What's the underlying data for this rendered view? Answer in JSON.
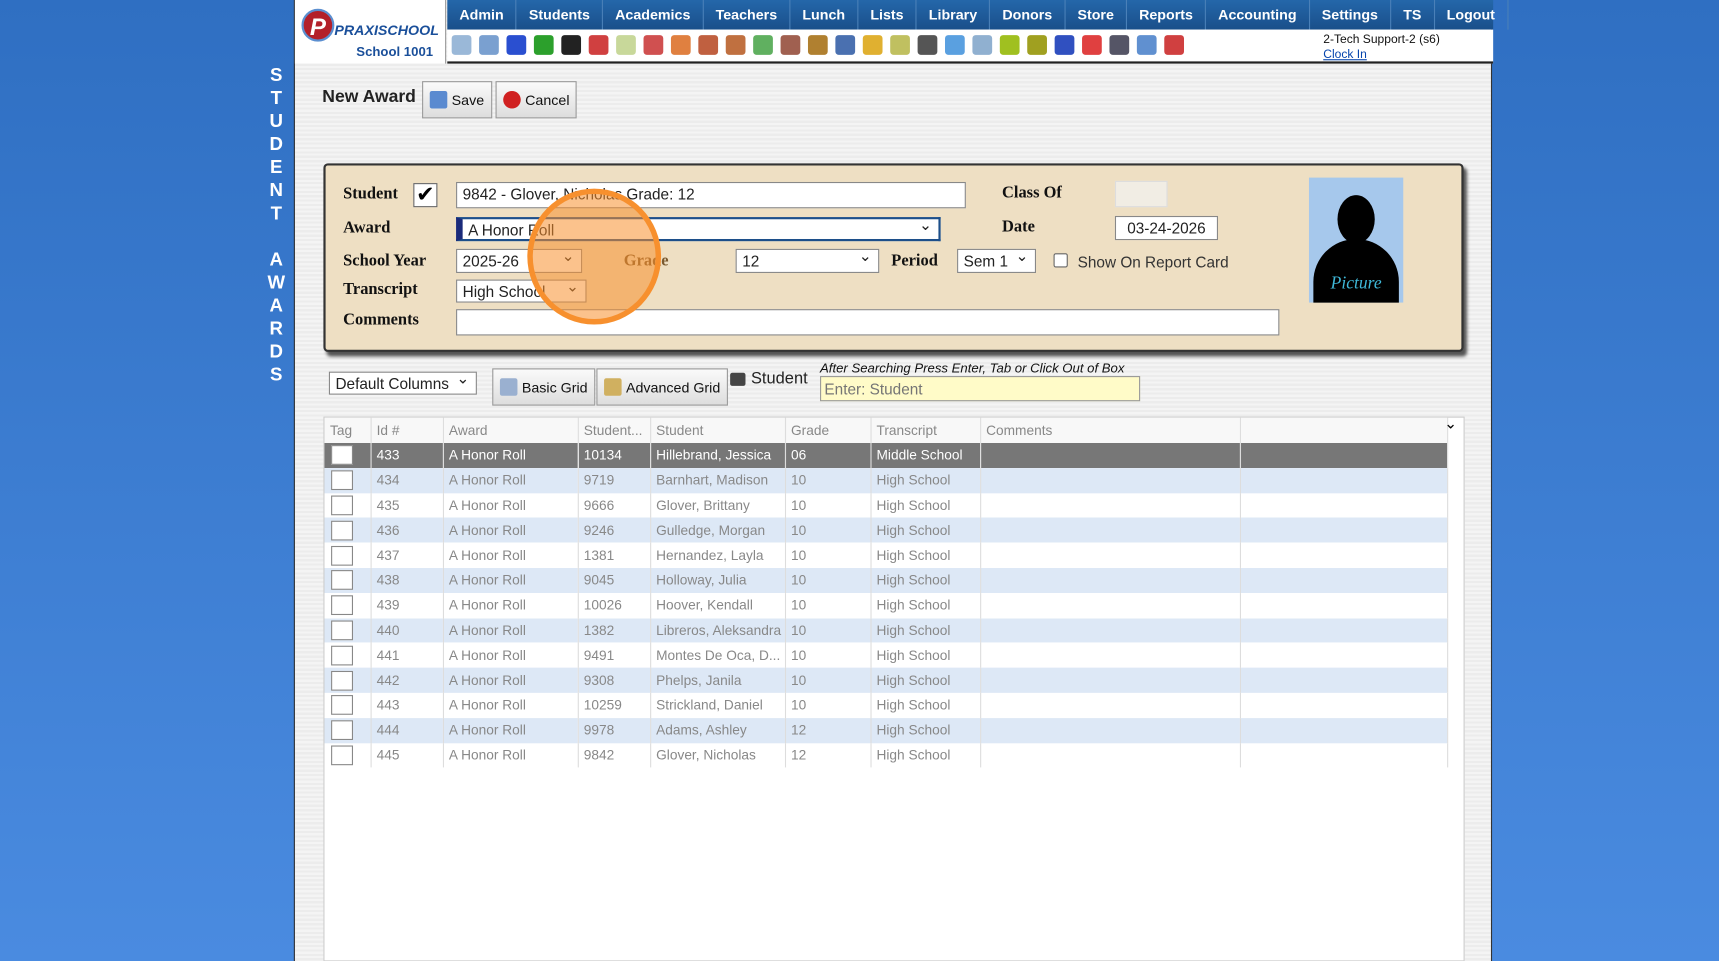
{
  "side_title": "STUDENT AWARDS",
  "logo": {
    "brand": "PRAXISCHOOL",
    "school": "School 1001"
  },
  "menu": [
    "Admin",
    "Students",
    "Academics",
    "Teachers",
    "Lunch",
    "Lists",
    "Library",
    "Donors",
    "Store",
    "Reports",
    "Accounting",
    "Settings",
    "TS",
    "Logout"
  ],
  "toolbar_icons": [
    {
      "n": "search-icon",
      "c": "#9ab8d8"
    },
    {
      "n": "calendar-grid-icon",
      "c": "#7aa0d0"
    },
    {
      "n": "email-icon",
      "c": "#2a4fd0"
    },
    {
      "n": "chat-icon",
      "c": "#2ca02c"
    },
    {
      "n": "phone-icon",
      "c": "#222"
    },
    {
      "n": "speaker-icon",
      "c": "#d04040"
    },
    {
      "n": "spreadsheet-icon",
      "c": "#c8d89a"
    },
    {
      "n": "calendar-icon",
      "c": "#d05050"
    },
    {
      "n": "megaphone-icon",
      "c": "#e08040"
    },
    {
      "n": "add-student-icon",
      "c": "#c06040"
    },
    {
      "n": "student-icon",
      "c": "#c07040"
    },
    {
      "n": "money-icon",
      "c": "#60b060"
    },
    {
      "n": "parents-icon",
      "c": "#a06050"
    },
    {
      "n": "lunch-icon",
      "c": "#b08030"
    },
    {
      "n": "book-icon",
      "c": "#4a70b0"
    },
    {
      "n": "bell-icon",
      "c": "#e0b030"
    },
    {
      "n": "export-icon",
      "c": "#c0c060"
    },
    {
      "n": "teacher-icon",
      "c": "#555"
    },
    {
      "n": "alarm-clock-icon",
      "c": "#5aa0e0"
    },
    {
      "n": "table-icon",
      "c": "#90b0d0"
    },
    {
      "n": "card-icon",
      "c": "#a0c020"
    },
    {
      "n": "printer-icon",
      "c": "#a0a020"
    },
    {
      "n": "ap-icon",
      "c": "#3050c0"
    },
    {
      "n": "pdf-icon",
      "c": "#e04040"
    },
    {
      "n": "cash-register-icon",
      "c": "#556"
    },
    {
      "n": "help-icon",
      "c": "#6090d0"
    },
    {
      "n": "alert-icon",
      "c": "#d04040"
    }
  ],
  "user": {
    "name": "2-Tech Support-2 (s6)",
    "clock": "Clock In"
  },
  "page": {
    "title": "New Award",
    "save": "Save",
    "cancel": "Cancel"
  },
  "form": {
    "student_label": "Student",
    "student_value": "9842 - Glover, Nicholas Grade: 12",
    "award_label": "Award",
    "award_value": "A Honor Roll",
    "year_label": "School Year",
    "year_value": "2025-26",
    "grade_label": "Grade",
    "grade_value": "12",
    "period_label": "Period",
    "period_value": "Sem 1",
    "show_label": "Show On Report Card",
    "transcript_label": "Transcript",
    "transcript_value": "High School",
    "comments_label": "Comments",
    "comments_value": "",
    "classof_label": "Class Of",
    "date_label": "Date",
    "date_value": "03-24-2026",
    "picture": "Picture"
  },
  "gridbar": {
    "columns": "Default Columns",
    "basic": "Basic Grid",
    "advanced": "Advanced Grid",
    "student": "Student",
    "hint": "After Searching Press Enter, Tab or Click Out of Box",
    "placeholder": "Enter: Student"
  },
  "table": {
    "headers": [
      "Tag",
      "Id #",
      "Award",
      "Student...",
      "Student",
      "Grade",
      "Transcript",
      "Comments",
      ""
    ],
    "rows": [
      [
        "433",
        "A Honor Roll",
        "10134",
        "Hillebrand, Jessica",
        "06",
        "Middle School"
      ],
      [
        "434",
        "A Honor Roll",
        "9719",
        "Barnhart, Madison",
        "10",
        "High School"
      ],
      [
        "435",
        "A Honor Roll",
        "9666",
        "Glover, Brittany",
        "10",
        "High School"
      ],
      [
        "436",
        "A Honor Roll",
        "9246",
        "Gulledge, Morgan",
        "10",
        "High School"
      ],
      [
        "437",
        "A Honor Roll",
        "1381",
        "Hernandez, Layla",
        "10",
        "High School"
      ],
      [
        "438",
        "A Honor Roll",
        "9045",
        "Holloway, Julia",
        "10",
        "High School"
      ],
      [
        "439",
        "A Honor Roll",
        "10026",
        "Hoover, Kendall",
        "10",
        "High School"
      ],
      [
        "440",
        "A Honor Roll",
        "1382",
        "Libreros, Aleksandra",
        "10",
        "High School"
      ],
      [
        "441",
        "A Honor Roll",
        "9491",
        "Montes De Oca, D...",
        "10",
        "High School"
      ],
      [
        "442",
        "A Honor Roll",
        "9308",
        "Phelps, Janila",
        "10",
        "High School"
      ],
      [
        "443",
        "A Honor Roll",
        "10259",
        "Strickland, Daniel",
        "10",
        "High School"
      ],
      [
        "444",
        "A Honor Roll",
        "9978",
        "Adams, Ashley",
        "12",
        "High School"
      ],
      [
        "445",
        "A Honor Roll",
        "9842",
        "Glover, Nicholas",
        "12",
        "High School"
      ]
    ]
  }
}
